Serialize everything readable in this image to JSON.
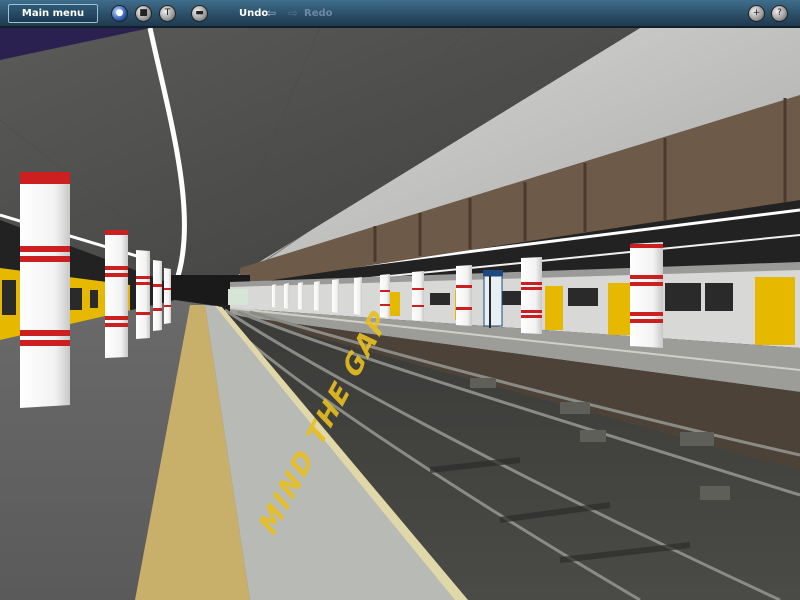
{
  "toolbar": {
    "main_menu_label": "Main menu",
    "undo_label": "Undo",
    "redo_label": "Redo",
    "buttons_left": [
      "globe-icon",
      "stop-icon",
      "wrench-icon",
      "disk-icon"
    ],
    "buttons_right": [
      "plus-icon",
      "help-icon"
    ]
  },
  "scene": {
    "platform_marking": "MIND THE GAP",
    "colors": {
      "toolbar": "#2a4d66",
      "train_yellow": "#e6b800",
      "pillar_red": "#cc1f1f",
      "platform_edge": "#d8c47a"
    }
  }
}
